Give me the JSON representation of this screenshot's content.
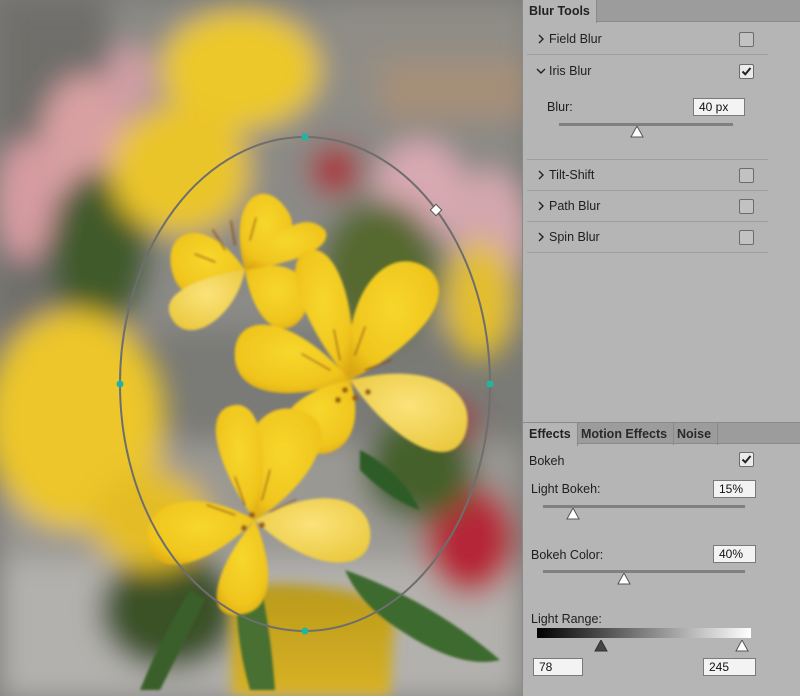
{
  "blur_tools": {
    "tab_label": "Blur Tools",
    "items": [
      {
        "label": "Field Blur",
        "expanded": false,
        "checked": false
      },
      {
        "label": "Iris Blur",
        "expanded": true,
        "checked": true
      },
      {
        "label": "Tilt-Shift",
        "expanded": false,
        "checked": false
      },
      {
        "label": "Path Blur",
        "expanded": false,
        "checked": false
      },
      {
        "label": "Spin Blur",
        "expanded": false,
        "checked": false
      }
    ],
    "iris": {
      "blur_label": "Blur:",
      "blur_value": "40 px",
      "blur_slider_fraction": 0.45
    }
  },
  "effects": {
    "tabs": [
      {
        "label": "Effects",
        "active": true
      },
      {
        "label": "Motion Effects",
        "active": false
      },
      {
        "label": "Noise",
        "active": false
      }
    ],
    "bokeh_label": "Bokeh",
    "bokeh_checked": true,
    "light_bokeh_label": "Light Bokeh:",
    "light_bokeh_value": "15%",
    "light_bokeh_fraction": 0.15,
    "bokeh_color_label": "Bokeh Color:",
    "bokeh_color_value": "40%",
    "bokeh_color_fraction": 0.4,
    "light_range_label": "Light Range:",
    "light_range_low": "78",
    "light_range_high": "245",
    "light_range_low_fraction": 0.3,
    "light_range_high_fraction": 0.96
  },
  "colors": {
    "panel_bg": "#b5b5b5",
    "tab_bar": "#9c9c9c",
    "handle": "#1fb5a0",
    "ellipse": "#6e6e6e"
  }
}
